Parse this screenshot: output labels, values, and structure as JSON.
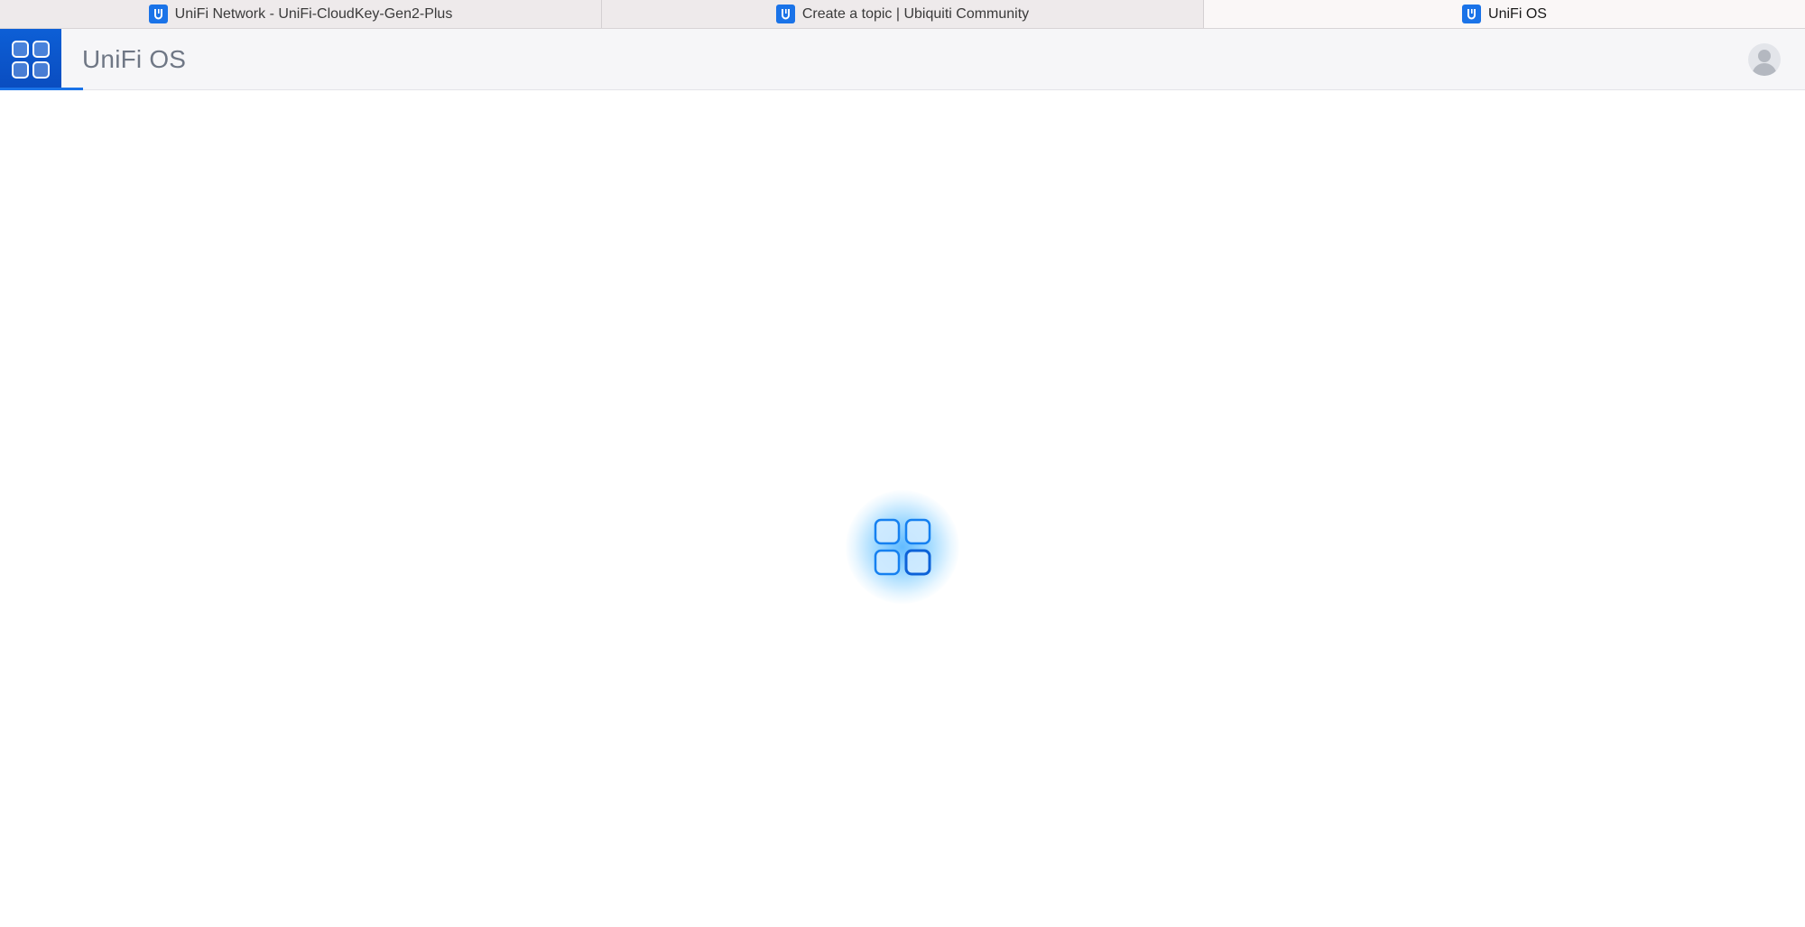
{
  "browser": {
    "tabs": [
      {
        "title": "UniFi Network - UniFi-CloudKey-Gen2-Plus",
        "favicon": "unifi-u-icon",
        "active": false
      },
      {
        "title": "Create a topic | Ubiquiti Community",
        "favicon": "unifi-u-icon",
        "active": false
      },
      {
        "title": "UniFi OS",
        "favicon": "unifi-u-icon",
        "active": true
      }
    ]
  },
  "header": {
    "title": "UniFi OS",
    "launcher_icon": "app-grid-icon",
    "avatar_icon": "user-avatar-icon"
  },
  "main": {
    "loading_icon": "app-grid-loading-icon",
    "state": "loading"
  },
  "colors": {
    "brand_blue": "#1a73e8",
    "launcher_blue": "#0a4cbf",
    "header_bg": "#f6f6f8",
    "title_gray": "#6f7785",
    "tab_bg": "#eeeaeb",
    "active_tab_bg": "#faf7f7"
  }
}
